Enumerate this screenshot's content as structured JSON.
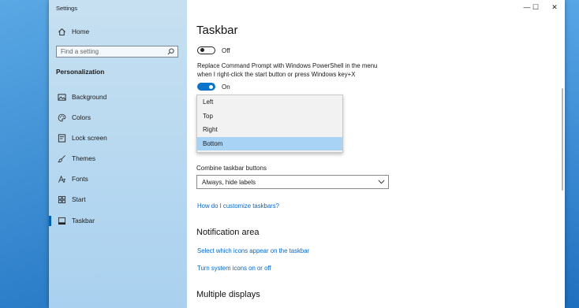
{
  "window": {
    "title": "Settings",
    "controls": {
      "minimize": "—",
      "maximize": "☐",
      "close": "✕"
    }
  },
  "sidebar": {
    "home_label": "Home",
    "search_placeholder": "Find a setting",
    "section_heading": "Personalization",
    "items": [
      {
        "label": "Background",
        "icon": "picture-icon",
        "selected": false
      },
      {
        "label": "Colors",
        "icon": "palette-icon",
        "selected": false
      },
      {
        "label": "Lock screen",
        "icon": "lock-screen-icon",
        "selected": false
      },
      {
        "label": "Themes",
        "icon": "brush-icon",
        "selected": false
      },
      {
        "label": "Fonts",
        "icon": "font-icon",
        "selected": false
      },
      {
        "label": "Start",
        "icon": "start-icon",
        "selected": false
      },
      {
        "label": "Taskbar",
        "icon": "taskbar-icon",
        "selected": true
      }
    ]
  },
  "main": {
    "page_title": "Taskbar",
    "toggle1": {
      "state_label": "Off",
      "on": false
    },
    "powershell_description": "Replace Command Prompt with Windows PowerShell in the menu when I right-click the start button or press Windows key+X",
    "toggle2": {
      "state_label": "On",
      "on": true
    },
    "location_dropdown": {
      "options": [
        "Left",
        "Top",
        "Right",
        "Bottom"
      ],
      "selected": "Bottom"
    },
    "combine_label": "Combine taskbar buttons",
    "combine_value": "Always, hide labels",
    "customize_link": "How do I customize taskbars?",
    "notification_heading": "Notification area",
    "notif_link1": "Select which icons appear on the taskbar",
    "notif_link2": "Turn system icons on or off",
    "multiple_displays_heading": "Multiple displays"
  },
  "colors": {
    "accent": "#0a73cc",
    "link": "#0a66c2",
    "sidebar_bg": "#b8d9f1",
    "dropdown_selected": "#a9d3f5"
  }
}
